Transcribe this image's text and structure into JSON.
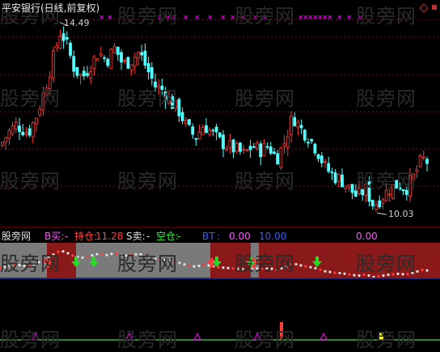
{
  "header": {
    "title": "平安银行(日线,前复权)"
  },
  "watermark": "股旁网",
  "price_panel": {
    "high_label": "14.49",
    "low_label": "10.03"
  },
  "indicator_header": {
    "name": "股旁网",
    "b_label": "B买:",
    "b_value": "-",
    "hold_label": "持仓:",
    "hold_value": "11.28",
    "s_label": "S卖:",
    "s_value": "-",
    "empty_label": "空仓:",
    "empty_value": "-",
    "bt_label": "BT",
    "bt_value": ":",
    "v1": "0.00",
    "v2": "10.00",
    "v3": "0.00"
  },
  "colors": {
    "up": "#ff3b3b",
    "down": "#54ffff",
    "band_red": "#8a1a1a",
    "band_gray": "#7a7a7a",
    "buy_arrow": "#ff3b3b",
    "sell_arrow": "#22dd22",
    "magenta": "#ff00ff",
    "yellow": "#ffff00"
  },
  "chart_data": {
    "type": "candlestick",
    "y_range": [
      9.9,
      14.6
    ],
    "annotations": [
      {
        "label": "14.49",
        "value": 14.49,
        "kind": "high"
      },
      {
        "label": "10.03",
        "value": 10.03,
        "kind": "low"
      }
    ],
    "signals_top": "xx x xxxxxxx xxxxxxxxxx x x",
    "buy_arrows_at": [
      60,
      262,
      313
    ],
    "sell_arrows_at": [
      94,
      116,
      268,
      310,
      392
    ]
  }
}
